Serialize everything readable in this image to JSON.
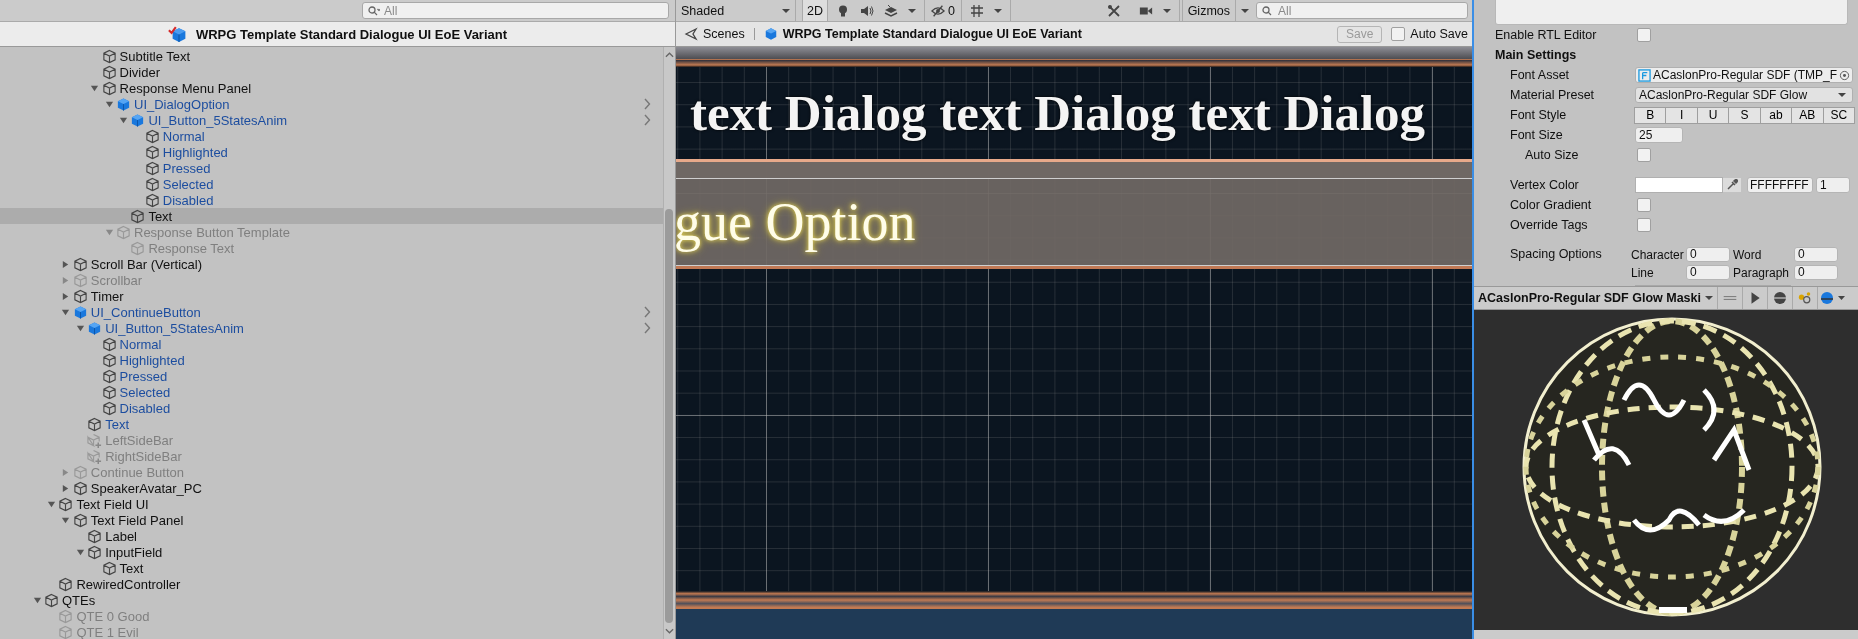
{
  "hierarchy": {
    "search": {
      "placeholder": "All"
    },
    "title": "WRPG Template Standard Dialogue UI EoE Variant",
    "tree": [
      {
        "children": [
          {
            "children": [
              {
                "children": [
                  {
                    "children": [
                      {
                        "label": "Subtitle Text",
                        "kind": "object",
                        "active": true,
                        "selected": false
                      },
                      {
                        "label": "Divider",
                        "kind": "object",
                        "active": true,
                        "selected": false
                      },
                      {
                        "label": "Response Menu Panel",
                        "kind": "object",
                        "active": true,
                        "selected": false,
                        "expanded": true,
                        "children": [
                          {
                            "label": "UI_DialogOption",
                            "kind": "prefab-root",
                            "active": true,
                            "selected": false,
                            "expanded": true,
                            "children": [
                              {
                                "label": "UI_Button_5StatesAnim",
                                "kind": "prefab-root",
                                "active": true,
                                "selected": false,
                                "expanded": true,
                                "children": [
                                  {
                                    "label": "Normal",
                                    "kind": "prefab-child",
                                    "active": true,
                                    "selected": false
                                  },
                                  {
                                    "label": "Highlighted",
                                    "kind": "prefab-child",
                                    "active": true,
                                    "selected": false
                                  },
                                  {
                                    "label": "Pressed",
                                    "kind": "prefab-child",
                                    "active": true,
                                    "selected": false
                                  },
                                  {
                                    "label": "Selected",
                                    "kind": "prefab-child",
                                    "active": true,
                                    "selected": false
                                  },
                                  {
                                    "label": "Disabled",
                                    "kind": "prefab-child",
                                    "active": true,
                                    "selected": false
                                  }
                                ]
                              },
                              {
                                "label": "Text",
                                "kind": "object",
                                "active": true,
                                "selected": true
                              }
                            ]
                          },
                          {
                            "label": "Response Button Template",
                            "kind": "object",
                            "active": false,
                            "selected": false,
                            "expanded": true,
                            "children": [
                              {
                                "label": "Response Text",
                                "kind": "object",
                                "active": false,
                                "selected": false
                              }
                            ]
                          }
                        ]
                      }
                    ]
                  }
                ]
              },
              {
                "label": "Scroll Bar (Vertical)",
                "kind": "object",
                "active": true,
                "selected": false,
                "expanded": false
              },
              {
                "label": "Scrollbar",
                "kind": "object",
                "active": false,
                "selected": false,
                "expanded": false
              },
              {
                "label": "Timer",
                "kind": "object",
                "active": true,
                "selected": false,
                "expanded": false
              },
              {
                "label": "UI_ContinueButton",
                "kind": "prefab-root",
                "active": true,
                "selected": false,
                "expanded": true,
                "children": [
                  {
                    "label": "UI_Button_5StatesAnim",
                    "kind": "prefab-root",
                    "active": true,
                    "selected": false,
                    "expanded": true,
                    "children": [
                      {
                        "label": "Normal",
                        "kind": "prefab-child",
                        "active": true,
                        "selected": false
                      },
                      {
                        "label": "Highlighted",
                        "kind": "prefab-child",
                        "active": true,
                        "selected": false
                      },
                      {
                        "label": "Pressed",
                        "kind": "prefab-child",
                        "active": true,
                        "selected": false
                      },
                      {
                        "label": "Selected",
                        "kind": "prefab-child",
                        "active": true,
                        "selected": false
                      },
                      {
                        "label": "Disabled",
                        "kind": "prefab-child",
                        "active": true,
                        "selected": false
                      }
                    ]
                  },
                  {
                    "label": "Text",
                    "kind": "prefab-child",
                    "active": true,
                    "selected": false
                  },
                  {
                    "label": "LeftSideBar",
                    "kind": "added",
                    "active": false,
                    "selected": false
                  },
                  {
                    "label": "RightSideBar",
                    "kind": "added",
                    "active": false,
                    "selected": false
                  }
                ]
              },
              {
                "label": "Continue Button",
                "kind": "object",
                "active": false,
                "selected": false,
                "expanded": false
              },
              {
                "label": "SpeakerAvatar_PC",
                "kind": "object",
                "active": true,
                "selected": false,
                "expanded": false
              }
            ]
          },
          {
            "label": "Text Field UI",
            "kind": "object",
            "active": true,
            "selected": false,
            "expanded": true,
            "children": [
              {
                "label": "Text Field Panel",
                "kind": "object",
                "active": true,
                "selected": false,
                "expanded": true,
                "children": [
                  {
                    "label": "Label",
                    "kind": "object",
                    "active": true,
                    "selected": false
                  },
                  {
                    "label": "InputField",
                    "kind": "object",
                    "active": true,
                    "selected": false,
                    "expanded": true,
                    "children": [
                      {
                        "label": "Text",
                        "kind": "object",
                        "active": true,
                        "selected": false
                      }
                    ]
                  }
                ]
              }
            ]
          },
          {
            "label": "RewiredController",
            "kind": "object",
            "active": true,
            "selected": false
          }
        ]
      },
      {
        "label": "QTEs",
        "kind": "object",
        "active": true,
        "selected": false,
        "expanded": true,
        "children": [
          {
            "label": "QTE 0 Good",
            "kind": "object",
            "active": false,
            "selected": false
          },
          {
            "label": "QTE 1 Evil",
            "kind": "object",
            "active": false,
            "selected": false
          }
        ]
      }
    ]
  },
  "scene": {
    "toolbar": {
      "shading": "Shaded",
      "mode_2d": {
        "label": "2D",
        "on": false
      },
      "hidden_count": "0",
      "gizmos": "Gizmos",
      "search": {
        "placeholder": "All"
      }
    },
    "breadcrumb": {
      "root": "Scenes",
      "prefab": "WRPG Template Standard Dialogue UI EoE Variant"
    },
    "save": {
      "label": "Save",
      "disabled": true
    },
    "auto_save": {
      "label": "Auto Save",
      "checked": false
    },
    "canvas": {
      "dialog_text": "text Dialog text Dialog text Dialog",
      "option_text": "gue Option"
    }
  },
  "inspector": {
    "fields": [
      {
        "kind": "checkbox",
        "label": "Enable RTL Editor",
        "checked": false
      },
      {
        "kind": "header",
        "label": "Main Settings",
        "children": [
          {
            "kind": "object",
            "label": "Font Asset",
            "value": "ACaslonPro-Regular SDF (TMP_F"
          },
          {
            "kind": "dropdown",
            "label": "Material Preset",
            "value": "ACaslonPro-Regular SDF Glow"
          },
          {
            "kind": "toggles",
            "label": "Font Style",
            "options": [
              {
                "label": "B",
                "on": false
              },
              {
                "label": "I",
                "on": false
              },
              {
                "label": "U",
                "on": false
              },
              {
                "label": "S",
                "on": false
              },
              {
                "label": "ab",
                "on": false
              },
              {
                "label": "AB",
                "on": false
              },
              {
                "label": "SC",
                "on": false
              }
            ]
          },
          {
            "kind": "number",
            "label": "Font Size",
            "value": "25",
            "children": [
              {
                "kind": "checkbox",
                "label": "Auto Size",
                "checked": false
              }
            ]
          },
          {
            "kind": "color",
            "label": "Vertex Color",
            "color": "#ffffff",
            "hex": "FFFFFFFF",
            "alpha": "1"
          },
          {
            "kind": "checkbox",
            "label": "Color Gradient",
            "checked": false
          },
          {
            "kind": "checkbox",
            "label": "Override Tags",
            "checked": false
          },
          {
            "kind": "spacing",
            "label": "Spacing Options",
            "values": [
              {
                "label": "Character",
                "value": "0"
              },
              {
                "label": "Word",
                "value": "0"
              },
              {
                "label": "Line",
                "value": "0"
              },
              {
                "label": "Paragraph",
                "value": "0"
              }
            ]
          }
        ]
      }
    ],
    "preview": {
      "material": "ACaslonPro-Regular SDF Glow Maski"
    }
  }
}
